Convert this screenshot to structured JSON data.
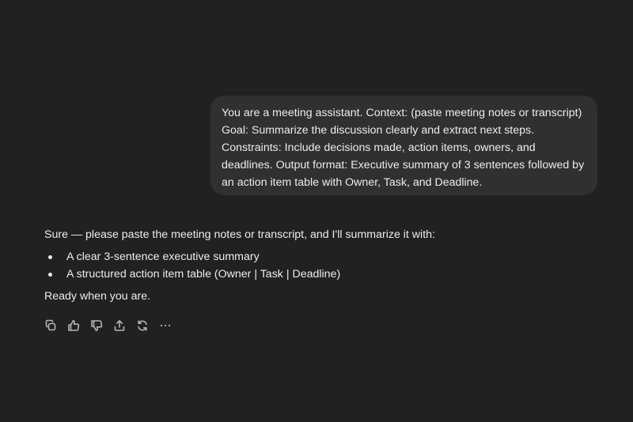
{
  "user_message": {
    "text": "You are a meeting assistant. Context: (paste meeting notes or transcript) Goal: Summarize the discussion clearly and extract next steps. Constraints: Include decisions made, action items, owners, and deadlines. Output format: Executive summary of 3 sentences followed by an action item table with Owner, Task, and Deadline."
  },
  "assistant_message": {
    "intro": "Sure — please paste the meeting notes or transcript, and I'll summarize it with:",
    "bullets": [
      "A clear 3-sentence executive summary",
      "A structured action item table (Owner | Task | Deadline)"
    ],
    "closing": "Ready when you are."
  },
  "actions": [
    {
      "icon": "copy-icon"
    },
    {
      "icon": "thumbs-up-icon"
    },
    {
      "icon": "thumbs-down-icon"
    },
    {
      "icon": "share-icon"
    },
    {
      "icon": "regenerate-icon"
    },
    {
      "icon": "more-icon"
    }
  ],
  "colors": {
    "background": "#212121",
    "bubble": "#303030",
    "text": "#ececec",
    "icon": "#b4b4b4"
  }
}
